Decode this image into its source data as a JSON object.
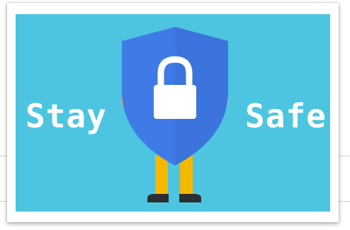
{
  "banner": {
    "word_left": "Stay",
    "word_right": "Safe"
  },
  "colors": {
    "background": "#4ec5e0",
    "shield": "#3f7be6",
    "shield_shade": "#3469c9",
    "lock": "#ffffff",
    "legs": "#f5b800",
    "shoes": "#2b2f33",
    "hands": "#e8a25f",
    "text": "#ffffff"
  },
  "icons": {
    "shield": "shield-icon",
    "lock": "padlock-icon"
  }
}
